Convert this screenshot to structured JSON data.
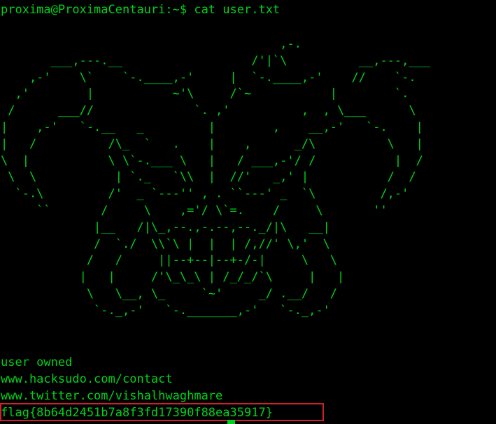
{
  "terminal": {
    "prompt": "proxima@ProximaCentauri:~$ cat user.txt",
    "ascii_art": [
      "                                       ,-.",
      "       ___,---.__                  /'|`\\          __,---,___",
      "    ,-'    \\`    `-.____,-'     |  `-.____,-'    //    `-.",
      "  ,'        |           ~'\\     /`~           |        `.",
      " /      ___//              `. ,'          ,  , \\___      \\",
      "|    ,-'   `-.__   _         |        ,    __,-'   `-.    |",
      "|   /          /\\_  `   .    |    ,      _/\\          \\   |",
      "\\  |           \\ \\`-.___ \\   |   / ___,-'/ /           |  /",
      " \\  \\           | `._   `\\\\  |  //'   _,' |           /  /",
      "  `-.\\         /'  _ `---'' , . ``---' _  `\\         /,-'",
      "     ``       /     \\    ,='/ \\`=.    /     \\       ''",
      "             |__   /|\\_,--.,-.--,--._/|\\   __|",
      "             /  `./  \\\\`\\ |  |  | /,//' \\,'  \\",
      "            /   /     ||--+--|--+-/-|     \\   \\",
      "           |   |     /'\\_\\_\\ | /_/_/`\\     |   |",
      "            \\   \\__, \\_     `~'     _/ .__/   /",
      "             `-._,-'   `-._______,-'   `-._,-'"
    ],
    "output_lines": [
      "user owned",
      "www.hacksudo.com/contact",
      "www.twitter.com/vishalhwaghmare"
    ],
    "flag": "flag{8b64d2451b7a8f3fd17390f88ea35917}",
    "colors": {
      "background": "#000000",
      "text": "#00d21a",
      "highlight_border": "#d0202a"
    }
  }
}
